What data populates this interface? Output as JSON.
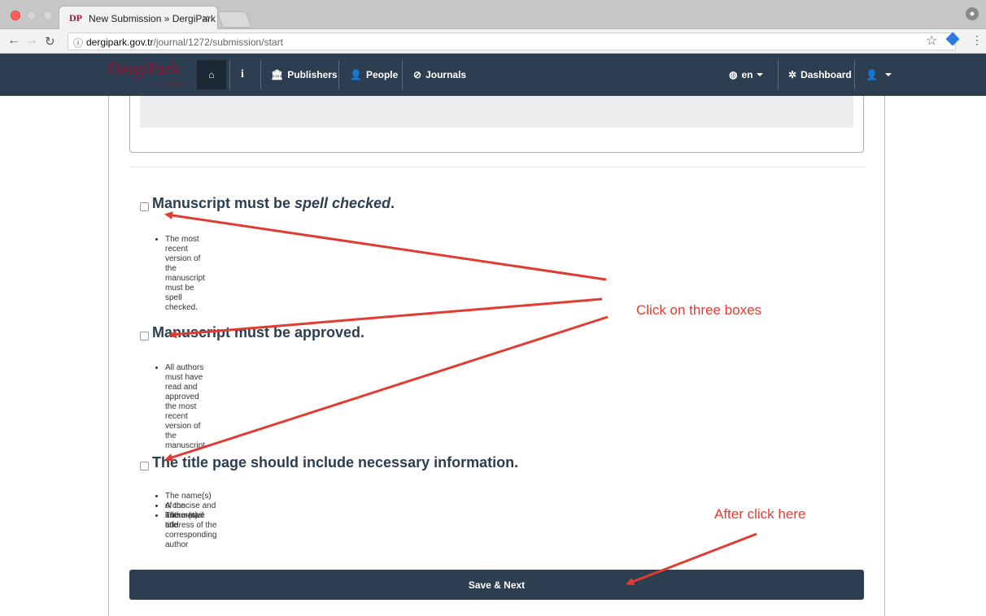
{
  "browser": {
    "tab_title": "New Submission » DergiPark",
    "tab_favicon": "DP",
    "tab_close": "×",
    "url_host": "dergipark.gov.tr",
    "url_path": "/journal/1272/submission/start",
    "icons": {
      "back": "arrow-left-icon",
      "forward": "arrow-right-icon",
      "reload": "reload-icon",
      "info": "info-circle-icon",
      "star": "star-icon",
      "extension": "extension-icon",
      "menu": "kebab-menu-icon",
      "profile": "profile-icon"
    }
  },
  "navbar": {
    "brand": "DergiPark",
    "brand_sub": "AKADEMİK",
    "items": [
      {
        "label": "",
        "icon": "home-icon"
      },
      {
        "label": "",
        "icon": "info-icon"
      },
      {
        "label": "Publishers",
        "icon": "institution-icon"
      },
      {
        "label": "People",
        "icon": "user-icon"
      },
      {
        "label": "Journals",
        "icon": "compass-icon"
      }
    ],
    "language": "en",
    "dashboard": "Dashboard",
    "account_icon": "user-icon"
  },
  "requirements": [
    {
      "title_prefix": "Manuscript must be ",
      "title_emphasis": "spell checked",
      "title_suffix": ".",
      "bullets": [
        "The most recent version of the manuscript must be spell checked."
      ],
      "checked": false
    },
    {
      "title_prefix": "Manuscript must be approved.",
      "title_emphasis": "",
      "title_suffix": "",
      "bullets": [
        "All authors must have read and approved the most recent version of the manuscript."
      ],
      "checked": false
    },
    {
      "title_prefix": "The title page should include necessary information.",
      "title_emphasis": "",
      "title_suffix": "",
      "bullets": [
        "The name(s) of the author(s)",
        "A concise and informative title",
        "The e-mail address of the corresponding author"
      ],
      "checked": false
    }
  ],
  "save_button": "Save & Next",
  "annotations": {
    "click_boxes": "Click on three boxes",
    "after_click": "After click here",
    "color": "#e03c31"
  },
  "colors": {
    "navbar": "#2c3e50",
    "brand": "#8b1538",
    "frame_border": "#9cc3e5"
  }
}
